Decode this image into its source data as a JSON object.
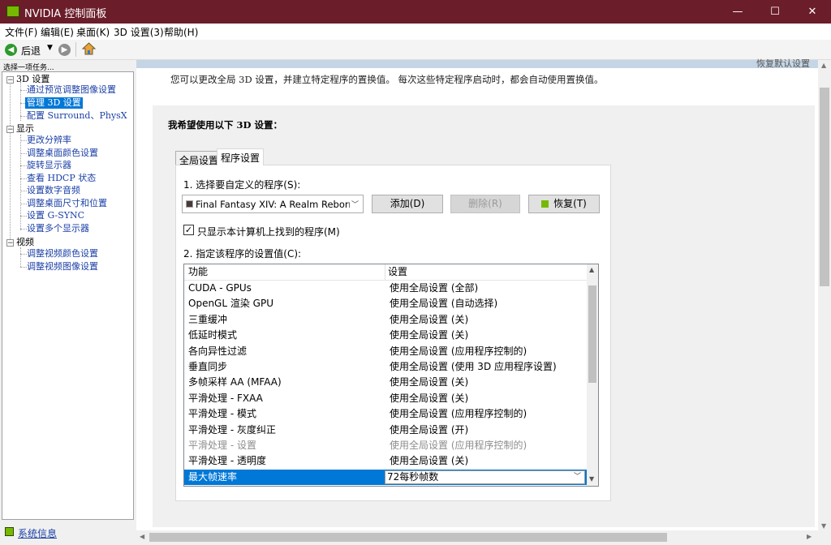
{
  "window": {
    "title": "NVIDIA 控制面板",
    "minimize": "—",
    "maximize": "☐",
    "close": "✕"
  },
  "menu": [
    "文件(F)",
    "编辑(E)",
    "桌面(K)",
    "3D 设置(3)",
    "帮助(H)"
  ],
  "toolbar": {
    "back": "后退"
  },
  "left": {
    "task_label": "选择一项任务...",
    "tree": [
      {
        "label": "3D 设置",
        "children": [
          "通过预览调整图像设置",
          "管理 3D 设置",
          "配置 Surround、PhysX"
        ],
        "selected": 1
      },
      {
        "label": "显示",
        "children": [
          "更改分辨率",
          "调整桌面颜色设置",
          "旋转显示器",
          "查看 HDCP 状态",
          "设置数字音频",
          "调整桌面尺寸和位置",
          "设置 G-SYNC",
          "设置多个显示器"
        ]
      },
      {
        "label": "视频",
        "children": [
          "调整视频颜色设置",
          "调整视频图像设置"
        ]
      }
    ],
    "system_info": "系统信息"
  },
  "main": {
    "restore_defaults": "恢复默认设置",
    "description": "您可以更改全局 3D 设置，并建立特定程序的置换值。 每次这些特定程序启动时，都会自动使用置换值。",
    "box_title": "我希望使用以下 3D 设置：",
    "tabs": [
      "全局设置",
      "程序设置"
    ],
    "active_tab": 1,
    "step1": "1. 选择要自定义的程序(S):",
    "program": "Final Fantasy XIV: A Realm Reborn (...",
    "add_button": "添加(D)",
    "remove_button": "删除(R)",
    "restore_button": "恢复(T)",
    "checkbox_label": "只显示本计算机上找到的程序(M)",
    "checkbox_checked": true,
    "step2": "2. 指定该程序的设置值(C):",
    "columns": [
      "功能",
      "设置"
    ],
    "rows": [
      {
        "feature": "CUDA - GPUs",
        "value": "使用全局设置 (全部)"
      },
      {
        "feature": "OpenGL 渲染 GPU",
        "value": "使用全局设置 (自动选择)"
      },
      {
        "feature": "三重缓冲",
        "value": "使用全局设置 (关)"
      },
      {
        "feature": "低延时模式",
        "value": "使用全局设置 (关)"
      },
      {
        "feature": "各向异性过滤",
        "value": "使用全局设置 (应用程序控制的)"
      },
      {
        "feature": "垂直同步",
        "value": "使用全局设置 (使用 3D 应用程序设置)"
      },
      {
        "feature": "多帧采样 AA (MFAA)",
        "value": "使用全局设置 (关)"
      },
      {
        "feature": "平滑处理 - FXAA",
        "value": "使用全局设置 (关)"
      },
      {
        "feature": "平滑处理 - 模式",
        "value": "使用全局设置 (应用程序控制的)"
      },
      {
        "feature": "平滑处理 - 灰度纠正",
        "value": "使用全局设置 (开)"
      },
      {
        "feature": "平滑处理 - 设置",
        "value": "使用全局设置 (应用程序控制的)",
        "disabled": true
      },
      {
        "feature": "平滑处理 - 透明度",
        "value": "使用全局设置 (关)"
      },
      {
        "feature": "最大帧速率",
        "value": "72每秒帧数",
        "selected": true
      }
    ]
  },
  "colors": {
    "titlebar": "#6b1d2a",
    "selection": "#0078d7",
    "nvidia_green": "#76b900",
    "link": "#1a3fa6"
  }
}
